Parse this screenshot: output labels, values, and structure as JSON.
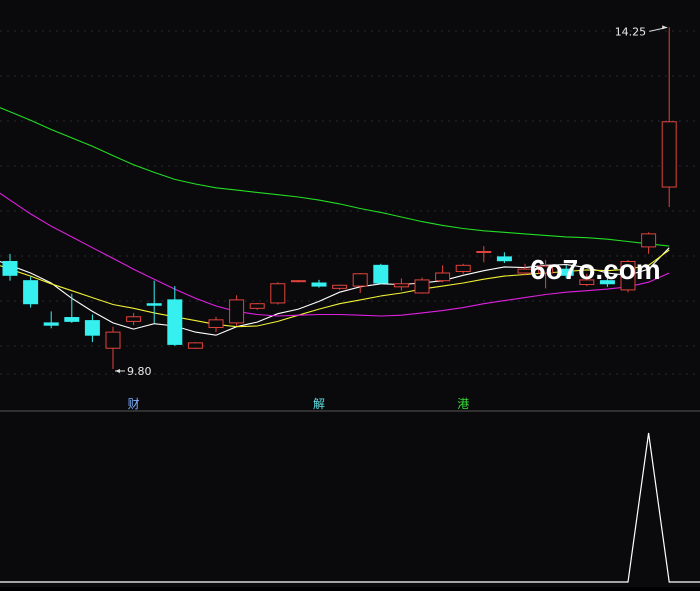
{
  "watermark": "6o7o.com",
  "chart_data": {
    "type": "candlestick",
    "annotations": {
      "high_label": "14.25",
      "low_label": "9.80",
      "event_markers": [
        {
          "index": 6,
          "label": "财",
          "color": "#7fb2ff"
        },
        {
          "index": 15,
          "label": "解",
          "color": "#5fe0e0"
        },
        {
          "index": 22,
          "label": "港",
          "color": "#33dd33"
        }
      ]
    },
    "colors": {
      "up": "#e0433b",
      "down": "#36f0f0",
      "background": "#0a0a0d",
      "grid": "#2a2a30",
      "ma_short": "#ffffff",
      "ma_mid": "#f0f035",
      "ma_long": "#e020e0",
      "ma_longest": "#22dd22",
      "indicator": "#ffffff"
    },
    "candles": [
      {
        "o": 11.2,
        "h": 11.3,
        "l": 10.95,
        "c": 11.02
      },
      {
        "o": 10.95,
        "h": 11.0,
        "l": 10.6,
        "c": 10.65
      },
      {
        "o": 10.4,
        "h": 10.55,
        "l": 10.33,
        "c": 10.37
      },
      {
        "o": 10.47,
        "h": 10.78,
        "l": 10.4,
        "c": 10.42
      },
      {
        "o": 10.43,
        "h": 10.51,
        "l": 10.15,
        "c": 10.24
      },
      {
        "o": 10.07,
        "h": 10.35,
        "l": 9.8,
        "c": 10.28
      },
      {
        "o": 10.42,
        "h": 10.53,
        "l": 10.37,
        "c": 10.48
      },
      {
        "o": 10.65,
        "h": 10.95,
        "l": 10.4,
        "c": 10.63
      },
      {
        "o": 10.7,
        "h": 10.88,
        "l": 10.1,
        "c": 10.12
      },
      {
        "o": 10.07,
        "h": 10.15,
        "l": 10.06,
        "c": 10.14
      },
      {
        "o": 10.34,
        "h": 10.48,
        "l": 10.28,
        "c": 10.44
      },
      {
        "o": 10.4,
        "h": 10.76,
        "l": 10.36,
        "c": 10.7
      },
      {
        "o": 10.59,
        "h": 10.66,
        "l": 10.57,
        "c": 10.65
      },
      {
        "o": 10.66,
        "h": 10.93,
        "l": 10.64,
        "c": 10.91
      },
      {
        "o": 10.94,
        "h": 10.96,
        "l": 10.93,
        "c": 10.95
      },
      {
        "o": 10.92,
        "h": 10.96,
        "l": 10.86,
        "c": 10.88
      },
      {
        "o": 10.85,
        "h": 10.9,
        "l": 10.83,
        "c": 10.89
      },
      {
        "o": 10.88,
        "h": 11.05,
        "l": 10.79,
        "c": 11.04
      },
      {
        "o": 11.15,
        "h": 11.17,
        "l": 10.91,
        "c": 10.92
      },
      {
        "o": 10.87,
        "h": 10.98,
        "l": 10.82,
        "c": 10.91
      },
      {
        "o": 10.79,
        "h": 10.99,
        "l": 10.78,
        "c": 10.96
      },
      {
        "o": 10.95,
        "h": 11.15,
        "l": 10.93,
        "c": 11.05
      },
      {
        "o": 11.07,
        "h": 11.17,
        "l": 11.04,
        "c": 11.15
      },
      {
        "o": 11.32,
        "h": 11.4,
        "l": 11.19,
        "c": 11.33
      },
      {
        "o": 11.26,
        "h": 11.32,
        "l": 11.18,
        "c": 11.21
      },
      {
        "o": 11.05,
        "h": 11.17,
        "l": 11.02,
        "c": 11.1
      },
      {
        "o": 11.05,
        "h": 11.22,
        "l": 10.85,
        "c": 11.14
      },
      {
        "o": 11.1,
        "h": 11.15,
        "l": 10.98,
        "c": 11.02
      },
      {
        "o": 10.9,
        "h": 11.04,
        "l": 10.88,
        "c": 10.96
      },
      {
        "o": 10.95,
        "h": 11.02,
        "l": 10.87,
        "c": 10.91
      },
      {
        "o": 10.83,
        "h": 11.22,
        "l": 10.8,
        "c": 11.2
      },
      {
        "o": 11.39,
        "h": 11.58,
        "l": 11.3,
        "c": 11.56
      },
      {
        "o": 12.17,
        "h": 14.25,
        "l": 11.91,
        "c": 13.02
      }
    ],
    "moving_averages": [
      {
        "color_key": "ma_short",
        "values": [
          11.15,
          11.05,
          10.92,
          10.72,
          10.55,
          10.4,
          10.32,
          10.39,
          10.36,
          10.28,
          10.24,
          10.35,
          10.41,
          10.52,
          10.58,
          10.68,
          10.8,
          10.87,
          10.91,
          10.9,
          10.92,
          10.95,
          11.02,
          11.08,
          11.13,
          11.12,
          11.15,
          11.16,
          11.12,
          11.05,
          11.02,
          11.1,
          11.38
        ]
      },
      {
        "color_key": "ma_mid",
        "values": [
          11.1,
          11.01,
          10.91,
          10.82,
          10.73,
          10.64,
          10.59,
          10.53,
          10.48,
          10.43,
          10.38,
          10.35,
          10.36,
          10.42,
          10.5,
          10.58,
          10.65,
          10.7,
          10.75,
          10.79,
          10.84,
          10.88,
          10.92,
          10.97,
          11.01,
          11.03,
          11.05,
          11.07,
          11.09,
          11.08,
          11.1,
          11.15,
          11.35
        ]
      },
      {
        "color_key": "ma_long",
        "values": [
          12.0,
          11.82,
          11.66,
          11.52,
          11.38,
          11.24,
          11.1,
          10.97,
          10.84,
          10.72,
          10.62,
          10.55,
          10.51,
          10.49,
          10.5,
          10.51,
          10.51,
          10.5,
          10.49,
          10.5,
          10.53,
          10.56,
          10.6,
          10.65,
          10.69,
          10.73,
          10.77,
          10.8,
          10.82,
          10.84,
          10.87,
          10.93,
          11.05
        ]
      },
      {
        "color_key": "ma_longest",
        "values": [
          13.15,
          13.04,
          12.92,
          12.81,
          12.7,
          12.58,
          12.46,
          12.36,
          12.27,
          12.21,
          12.16,
          12.13,
          12.1,
          12.07,
          12.04,
          12.0,
          11.95,
          11.89,
          11.84,
          11.78,
          11.72,
          11.67,
          11.63,
          11.6,
          11.58,
          11.56,
          11.54,
          11.52,
          11.51,
          11.49,
          11.46,
          11.43,
          11.4
        ]
      }
    ],
    "indicator": {
      "type": "line",
      "values": [
        0,
        0,
        0,
        0,
        0,
        0,
        0,
        0,
        0,
        0,
        0,
        0,
        0,
        0,
        0,
        0,
        0,
        0,
        0,
        0,
        0,
        0,
        0,
        0,
        0,
        0,
        0,
        0,
        0,
        0,
        0,
        1,
        0
      ]
    },
    "ylim": [
      9.5,
      14.45
    ]
  }
}
